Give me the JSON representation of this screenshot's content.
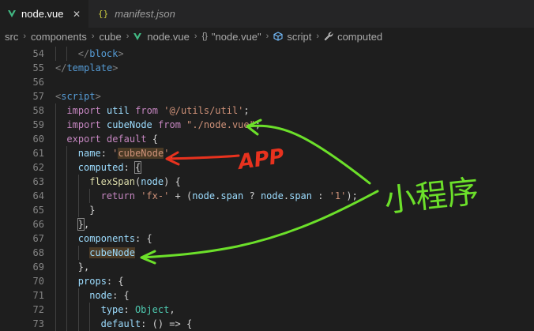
{
  "tabs": [
    {
      "label": "node.vue",
      "icon": "vue-icon",
      "active": true
    },
    {
      "label": "manifest.json",
      "icon": "json-icon",
      "active": false
    }
  ],
  "breadcrumb": {
    "parts": [
      "src",
      "components",
      "cube",
      "node.vue",
      "\"node.vue\"",
      "script",
      "computed"
    ]
  },
  "annotations": {
    "app_label": "APP",
    "miniprogram_label": "小程序"
  },
  "editor": {
    "lines": [
      {
        "n": "54",
        "indent": 2,
        "tokens": [
          [
            "t-punc",
            "</"
          ],
          [
            "t-tag",
            "block"
          ],
          [
            "t-punc",
            ">"
          ]
        ]
      },
      {
        "n": "55",
        "indent": 0,
        "tokens": [
          [
            "t-punc",
            "</"
          ],
          [
            "t-tag",
            "template"
          ],
          [
            "t-punc",
            ">"
          ]
        ]
      },
      {
        "n": "56",
        "indent": 0,
        "tokens": []
      },
      {
        "n": "57",
        "indent": 0,
        "tokens": [
          [
            "t-punc",
            "<"
          ],
          [
            "t-tag",
            "script"
          ],
          [
            "t-punc",
            ">"
          ]
        ]
      },
      {
        "n": "58",
        "indent": 1,
        "tokens": [
          [
            "t-kw",
            "import"
          ],
          [
            "t-def",
            " "
          ],
          [
            "t-var",
            "util"
          ],
          [
            "t-def",
            " "
          ],
          [
            "t-kw",
            "from"
          ],
          [
            "t-def",
            " "
          ],
          [
            "t-str",
            "'@/utils/util'"
          ],
          [
            "t-def",
            ";"
          ]
        ]
      },
      {
        "n": "59",
        "indent": 1,
        "tokens": [
          [
            "t-kw",
            "import"
          ],
          [
            "t-def",
            " "
          ],
          [
            "t-var",
            "cubeNode"
          ],
          [
            "t-def",
            " "
          ],
          [
            "t-kw",
            "from"
          ],
          [
            "t-def",
            " "
          ],
          [
            "t-str",
            "\"./node.vue\""
          ],
          [
            "t-def",
            ";"
          ]
        ]
      },
      {
        "n": "60",
        "indent": 1,
        "tokens": [
          [
            "t-kw",
            "export"
          ],
          [
            "t-def",
            " "
          ],
          [
            "t-kw",
            "default"
          ],
          [
            "t-def",
            " {"
          ]
        ]
      },
      {
        "n": "61",
        "indent": 2,
        "tokens": [
          [
            "t-prop",
            "name"
          ],
          [
            "t-def",
            ": "
          ],
          [
            "t-str",
            "'"
          ],
          [
            "t-str hl",
            "cubeNode"
          ],
          [
            "t-str",
            "'"
          ],
          [
            "t-def",
            ","
          ]
        ]
      },
      {
        "n": "62",
        "indent": 2,
        "tokens": [
          [
            "t-prop",
            "computed"
          ],
          [
            "t-def",
            ": "
          ],
          [
            "t-def bracket-box",
            "{"
          ]
        ]
      },
      {
        "n": "63",
        "indent": 3,
        "tokens": [
          [
            "t-fn",
            "flexSpan"
          ],
          [
            "t-def",
            "("
          ],
          [
            "t-var",
            "node"
          ],
          [
            "t-def",
            ") {"
          ]
        ]
      },
      {
        "n": "64",
        "indent": 4,
        "tokens": [
          [
            "t-kw",
            "return"
          ],
          [
            "t-def",
            " "
          ],
          [
            "t-str",
            "'fx-'"
          ],
          [
            "t-def",
            " + ("
          ],
          [
            "t-var",
            "node"
          ],
          [
            "t-def",
            "."
          ],
          [
            "t-var",
            "span"
          ],
          [
            "t-def",
            " ? "
          ],
          [
            "t-var",
            "node"
          ],
          [
            "t-def",
            "."
          ],
          [
            "t-var",
            "span"
          ],
          [
            "t-def",
            " : "
          ],
          [
            "t-str",
            "'1'"
          ],
          [
            "t-def",
            ");"
          ]
        ]
      },
      {
        "n": "65",
        "indent": 3,
        "tokens": [
          [
            "t-def",
            "}"
          ]
        ]
      },
      {
        "n": "66",
        "indent": 2,
        "tokens": [
          [
            "t-def bracket-box",
            "}"
          ],
          [
            "t-def",
            ","
          ]
        ]
      },
      {
        "n": "67",
        "indent": 2,
        "tokens": [
          [
            "t-prop",
            "components"
          ],
          [
            "t-def",
            ": {"
          ]
        ]
      },
      {
        "n": "68",
        "indent": 3,
        "tokens": [
          [
            "t-var hl",
            "cubeNode"
          ]
        ]
      },
      {
        "n": "69",
        "indent": 2,
        "tokens": [
          [
            "t-def",
            "},"
          ]
        ]
      },
      {
        "n": "70",
        "indent": 2,
        "tokens": [
          [
            "t-prop",
            "props"
          ],
          [
            "t-def",
            ": {"
          ]
        ]
      },
      {
        "n": "71",
        "indent": 3,
        "tokens": [
          [
            "t-prop",
            "node"
          ],
          [
            "t-def",
            ": {"
          ]
        ]
      },
      {
        "n": "72",
        "indent": 4,
        "tokens": [
          [
            "t-prop",
            "type"
          ],
          [
            "t-def",
            ": "
          ],
          [
            "t-type",
            "Object"
          ],
          [
            "t-def",
            ","
          ]
        ]
      },
      {
        "n": "73",
        "indent": 4,
        "tokens": [
          [
            "t-prop",
            "default"
          ],
          [
            "t-def",
            ": () => {"
          ]
        ]
      }
    ]
  }
}
